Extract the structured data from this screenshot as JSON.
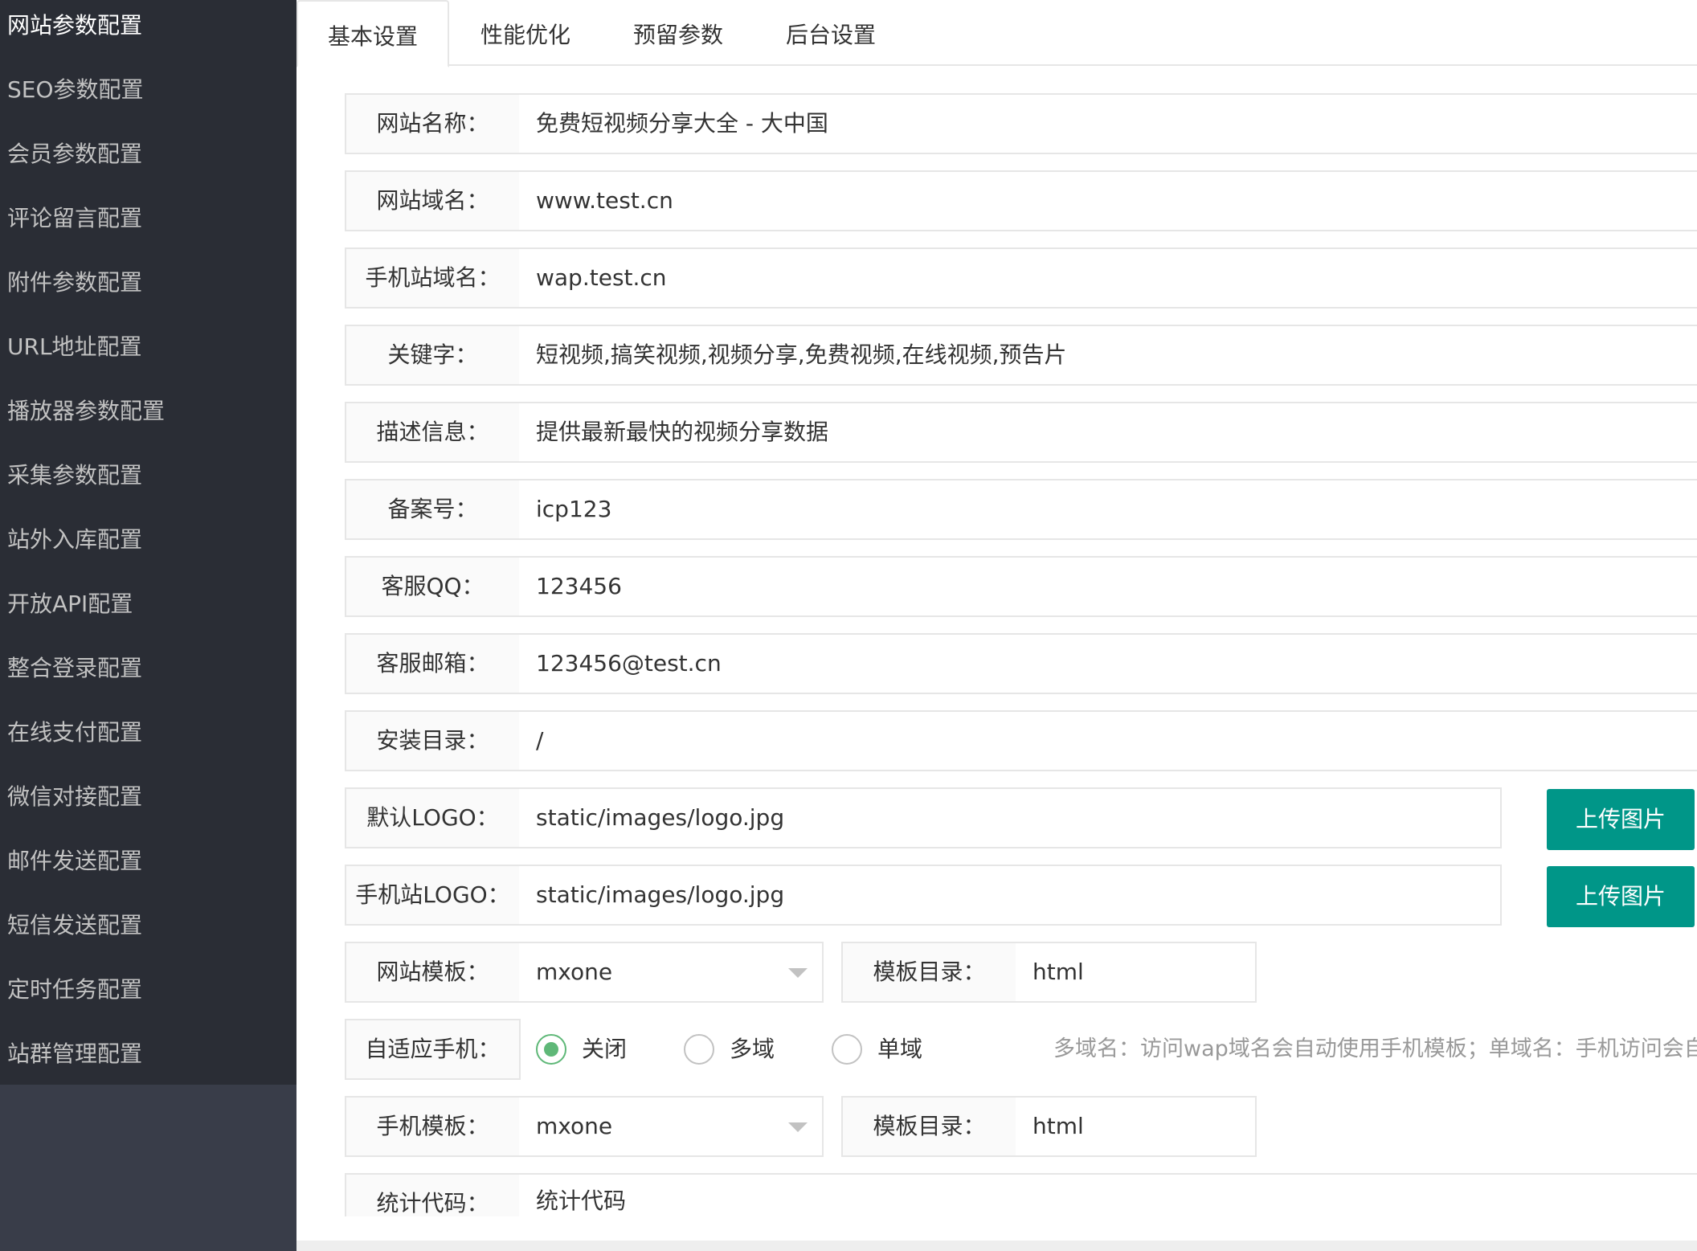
{
  "sidebar": {
    "items": [
      {
        "label": "网站参数配置"
      },
      {
        "label": "SEO参数配置"
      },
      {
        "label": "会员参数配置"
      },
      {
        "label": "评论留言配置"
      },
      {
        "label": "附件参数配置"
      },
      {
        "label": "URL地址配置"
      },
      {
        "label": "播放器参数配置"
      },
      {
        "label": "采集参数配置"
      },
      {
        "label": "站外入库配置"
      },
      {
        "label": "开放API配置"
      },
      {
        "label": "整合登录配置"
      },
      {
        "label": "在线支付配置"
      },
      {
        "label": "微信对接配置"
      },
      {
        "label": "邮件发送配置"
      },
      {
        "label": "短信发送配置"
      },
      {
        "label": "定时任务配置"
      },
      {
        "label": "站群管理配置"
      }
    ]
  },
  "tabs": [
    {
      "label": "基本设置"
    },
    {
      "label": "性能优化"
    },
    {
      "label": "预留参数"
    },
    {
      "label": "后台设置"
    }
  ],
  "form": {
    "site_name": {
      "label": "网站名称：",
      "value": "免费短视频分享大全 - 大中国"
    },
    "site_domain": {
      "label": "网站域名：",
      "value": "www.test.cn"
    },
    "mobile_domain": {
      "label": "手机站域名：",
      "value": "wap.test.cn"
    },
    "keywords": {
      "label": "关键字：",
      "value": "短视频,搞笑视频,视频分享,免费视频,在线视频,预告片"
    },
    "description": {
      "label": "描述信息：",
      "value": "提供最新最快的视频分享数据"
    },
    "icp": {
      "label": "备案号：",
      "value": "icp123"
    },
    "qq": {
      "label": "客服QQ：",
      "value": "123456"
    },
    "email": {
      "label": "客服邮箱：",
      "value": "123456@test.cn"
    },
    "install_dir": {
      "label": "安装目录：",
      "value": "/"
    },
    "logo": {
      "label": "默认LOGO：",
      "value": "static/images/logo.jpg",
      "button": "上传图片"
    },
    "mobile_logo": {
      "label": "手机站LOGO：",
      "value": "static/images/logo.jpg",
      "button": "上传图片"
    },
    "template": {
      "label": "网站模板：",
      "value": "mxone",
      "dir_label": "模板目录：",
      "dir_value": "html"
    },
    "adaptive": {
      "label": "自适应手机：",
      "options": [
        "关闭",
        "多域",
        "单域"
      ],
      "selected": "关闭",
      "hint": "多域名：访问wap域名会自动使用手机模板；单域名：手机访问会自动"
    },
    "mobile_template": {
      "label": "手机模板：",
      "value": "mxone",
      "dir_label": "模板目录：",
      "dir_value": "html"
    },
    "stats_code": {
      "label": "统计代码：",
      "value": "统计代码"
    }
  },
  "colors": {
    "sidebar_bg": "#2a2d35",
    "sidebar_bottom": "#393d49",
    "accent_button": "#009688",
    "radio_checked": "#5fb878"
  }
}
